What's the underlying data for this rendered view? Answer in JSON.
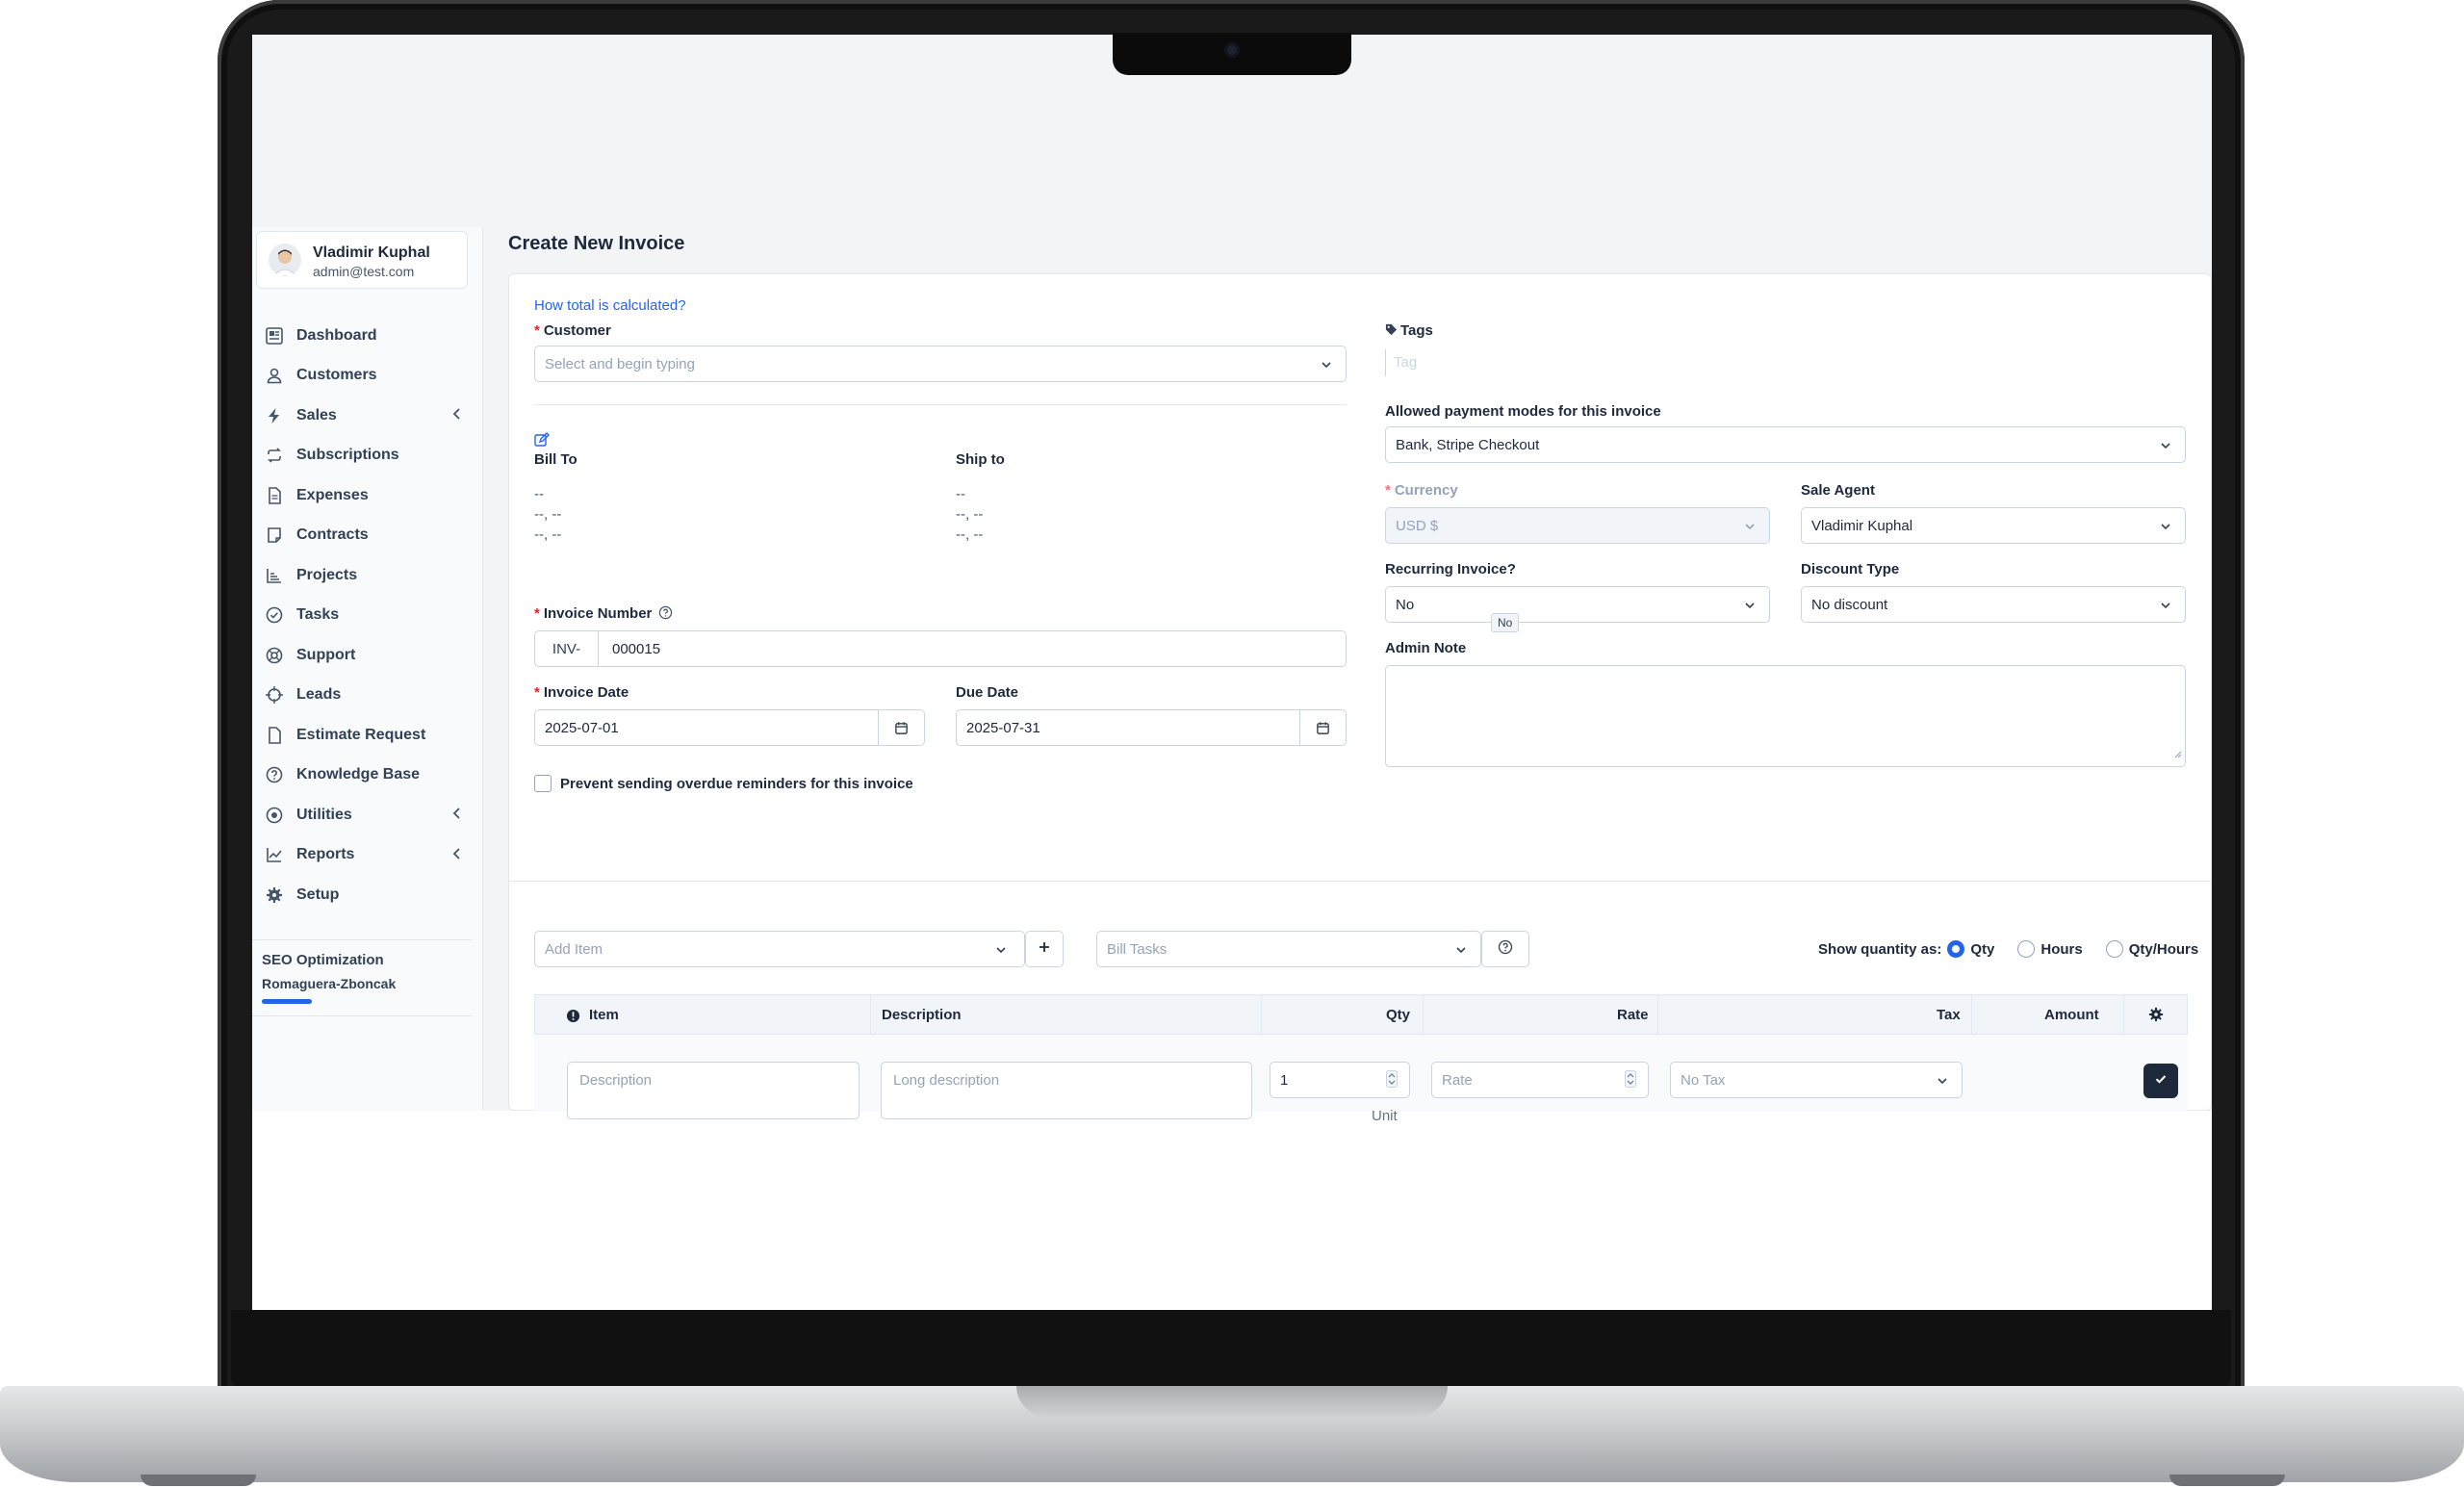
{
  "user": {
    "name": "Vladimir Kuphal",
    "email": "admin@test.com"
  },
  "sidebar": {
    "items": [
      {
        "label": "Dashboard",
        "icon": "dashboard-icon"
      },
      {
        "label": "Customers",
        "icon": "user-icon"
      },
      {
        "label": "Sales",
        "icon": "bolt-icon",
        "expandable": true
      },
      {
        "label": "Subscriptions",
        "icon": "repeat-icon"
      },
      {
        "label": "Expenses",
        "icon": "file-icon"
      },
      {
        "label": "Contracts",
        "icon": "contract-icon"
      },
      {
        "label": "Projects",
        "icon": "chart-icon"
      },
      {
        "label": "Tasks",
        "icon": "check-circle-icon"
      },
      {
        "label": "Support",
        "icon": "lifebuoy-icon"
      },
      {
        "label": "Leads",
        "icon": "crosshair-icon"
      },
      {
        "label": "Estimate Request",
        "icon": "file-icon"
      },
      {
        "label": "Knowledge Base",
        "icon": "question-circle-icon"
      },
      {
        "label": "Utilities",
        "icon": "dot-circle-icon",
        "expandable": true
      },
      {
        "label": "Reports",
        "icon": "line-chart-icon",
        "expandable": true
      },
      {
        "label": "Setup",
        "icon": "gear-icon"
      }
    ],
    "project": {
      "title": "SEO Optimization",
      "client": "Romaguera-Zboncak"
    }
  },
  "page": {
    "title": "Create New Invoice"
  },
  "form": {
    "help_link": "How total is calculated?",
    "customer_label": "Customer",
    "customer_placeholder": "Select and begin typing",
    "bill_to_label": "Bill To",
    "ship_to_label": "Ship to",
    "bill_to_lines": [
      "--",
      "--, --",
      "--, --"
    ],
    "ship_to_lines": [
      "--",
      "--, --",
      "--, --"
    ],
    "invoice_number_label": "Invoice Number",
    "invoice_prefix": "INV-",
    "invoice_number": "000015",
    "invoice_date_label": "Invoice Date",
    "invoice_date": "2025-07-01",
    "due_date_label": "Due Date",
    "due_date": "2025-07-31",
    "prevent_reminders_label": "Prevent sending overdue reminders for this invoice",
    "tags_label": "Tags",
    "tags_placeholder": "Tag",
    "payment_modes_label": "Allowed payment modes for this invoice",
    "payment_modes_value": "Bank, Stripe Checkout",
    "currency_label": "Currency",
    "currency_value": "USD $",
    "sale_agent_label": "Sale Agent",
    "sale_agent_value": "Vladimir Kuphal",
    "recurring_label": "Recurring Invoice?",
    "recurring_value": "No",
    "recurring_tooltip": "No",
    "discount_type_label": "Discount Type",
    "discount_type_value": "No discount",
    "admin_note_label": "Admin Note"
  },
  "items": {
    "add_item_placeholder": "Add Item",
    "bill_tasks_placeholder": "Bill Tasks",
    "show_qty_label": "Show quantity as:",
    "qty_options": [
      "Qty",
      "Hours",
      "Qty/Hours"
    ],
    "qty_selected": "Qty",
    "columns": [
      "Item",
      "Description",
      "Qty",
      "Rate",
      "Tax",
      "Amount"
    ],
    "row": {
      "description_placeholder": "Description",
      "long_description_placeholder": "Long description",
      "qty_value": "1",
      "unit_placeholder": "Unit",
      "rate_placeholder": "Rate",
      "tax_value": "No Tax"
    }
  },
  "colors": {
    "accent": "#2563eb",
    "required": "#dc2626",
    "dark_button": "#1e293b"
  }
}
